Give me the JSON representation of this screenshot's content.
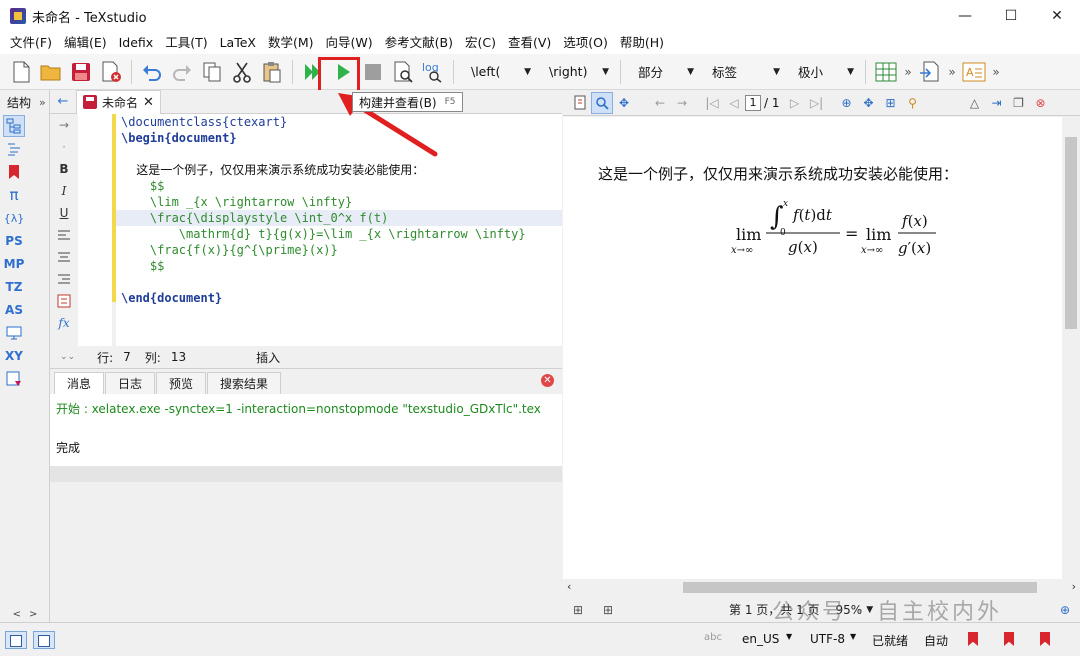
{
  "window": {
    "title": "未命名 - TeXstudio",
    "minimize": "—",
    "maximize": "☐",
    "close": "✕"
  },
  "menu": [
    "文件(F)",
    "编辑(E)",
    "Idefix",
    "工具(T)",
    "LaTeX",
    "数学(M)",
    "向导(W)",
    "参考文献(B)",
    "宏(C)",
    "查看(V)",
    "选项(O)",
    "帮助(H)"
  ],
  "toolbar": {
    "combos": {
      "left": "\\left(",
      "right": "\\right)",
      "section": "部分",
      "label": "标签",
      "size": "极小"
    },
    "tooltip": {
      "label": "构建并查看(B)",
      "shortcut": "F5"
    }
  },
  "structure": {
    "label": "结构",
    "more": "»",
    "icons": [
      "PS",
      "MP",
      "TZ",
      "AS",
      "XY"
    ],
    "bottom_left": "<",
    "bottom_right": ">"
  },
  "editor": {
    "tab_name": "未命名",
    "lines": [
      {
        "cmd": "\\documentclass",
        "arg": "{ctexart}",
        "kind": "cmd"
      },
      {
        "cmd": "\\begin",
        "arg": "{document}",
        "kind": "kw"
      },
      {
        "text": "",
        "kind": "blank"
      },
      {
        "text": "    这是一个例子，仅仅用来演示系统成功安装必能使用：",
        "kind": "text"
      },
      {
        "text": "    $$",
        "kind": "math"
      },
      {
        "text": "    \\lim _{x \\rightarrow \\infty}",
        "kind": "math"
      },
      {
        "text": "    \\frac{\\displaystyle \\int_0^x f(t)",
        "kind": "math",
        "hl": true
      },
      {
        "text": "        \\mathrm{d} t}{g(x)}=\\lim _{x \\rightarrow \\infty}",
        "kind": "math"
      },
      {
        "text": "    \\frac{f(x)}{g^{\\prime}(x)}",
        "kind": "math"
      },
      {
        "text": "    $$",
        "kind": "math"
      },
      {
        "text": "",
        "kind": "blank"
      },
      {
        "cmd": "\\end",
        "arg": "{document}",
        "kind": "kw"
      }
    ],
    "status": {
      "line_label": "行:",
      "line": "7",
      "col_label": "列:",
      "col": "13",
      "mode": "插入"
    }
  },
  "messages": {
    "tabs": [
      "消息",
      "日志",
      "预览",
      "搜索结果"
    ],
    "active_tab": 0,
    "start_line": "开始 : xelatex.exe -synctex=1 -interaction=nonstopmode \"texstudio_GDxTlc\".tex",
    "done": "完成"
  },
  "viewer": {
    "page": "1",
    "total": "/ 1",
    "paragraph": "这是一个例子，仅仅用来演示系统成功安装必能使用：",
    "page_info": "第 1 页，共 1 页",
    "zoom": "95%"
  },
  "watermark": "公众号 · 自主校内外",
  "statusbar": {
    "spell": "abc",
    "language": "en_US",
    "encoding": "UTF-8",
    "state": "已就绪",
    "auto": "自动"
  }
}
